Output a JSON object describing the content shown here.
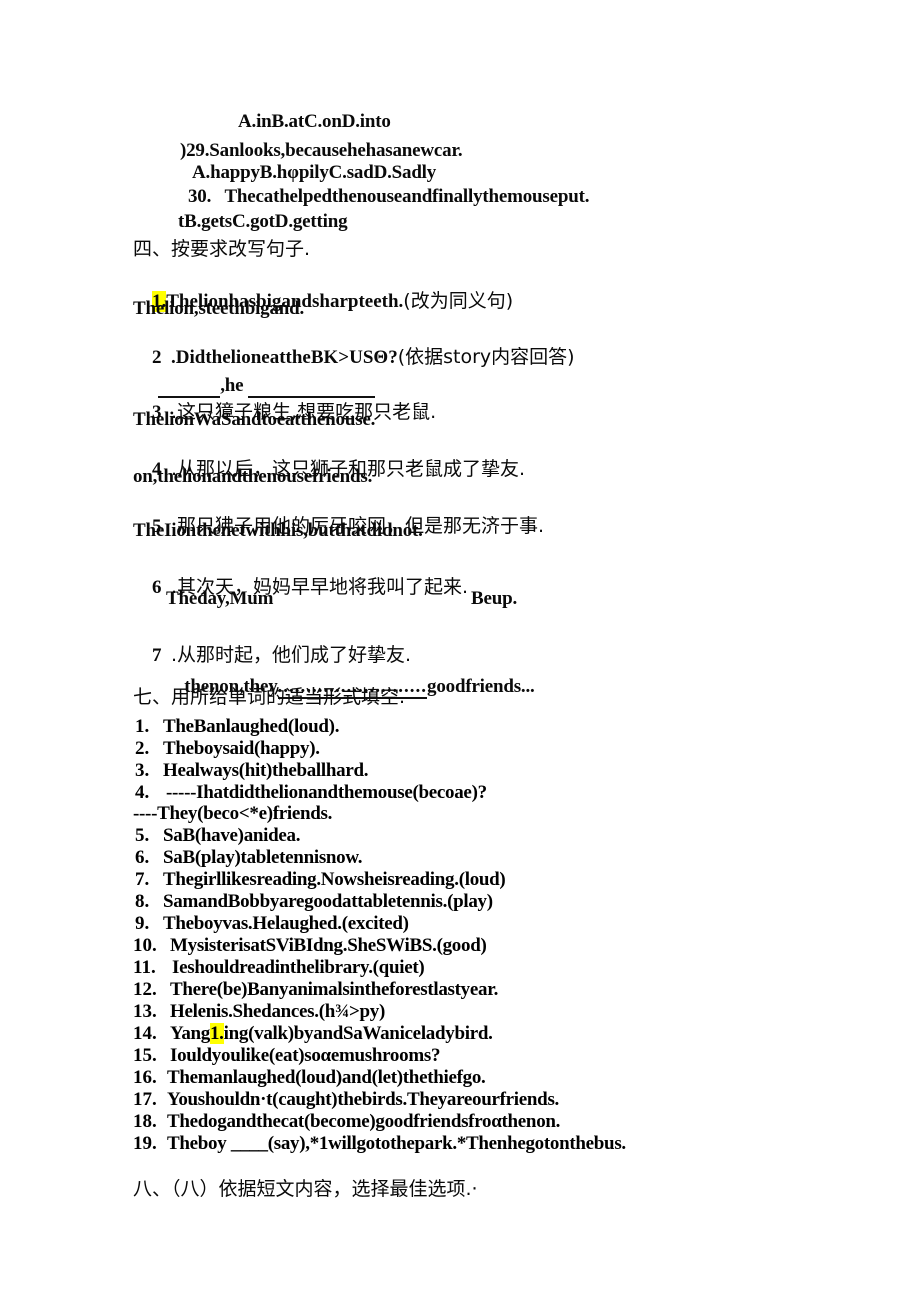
{
  "document": {
    "kind": "scanned-worksheet-page",
    "background_color": "#ffffff",
    "text_color": "#000000",
    "highlight_color": "#ffff00"
  },
  "top_questions": {
    "q28_options": "A.inB.atC.onD.into",
    "q29_stem": ")29.Sanlooks,becausehehasanewcar.",
    "q29_options": "A.happyB.hφpilyC.sadD.Sadly",
    "q30_stem": "30.   Thecathelpedthenouseandfinallythemouseput.",
    "q30_options": "tB.getsC.gotD.getting"
  },
  "section_four": {
    "heading": "四、按要求改写句子.",
    "items": [
      {
        "number": "1.",
        "number_highlighted": true,
        "prompt_en": "Thelionhasbigandsharpteeth.",
        "prompt_cn": "(改为同义句)",
        "answer": "Thelion,steethbigand."
      },
      {
        "number": "2",
        "prompt_en": ".DidthelioneattheBK>USΘ?",
        "prompt_cn": "(依据story内容回答)",
        "answer_fragment": ",he"
      },
      {
        "number": "3",
        "prompt_cn": ".这只獐子粮生,想要吃那只老鼠.",
        "answer": "ThelionWaSandtoeatthenouse."
      },
      {
        "number": "4",
        "prompt_cn": ".从那以后，这只狮子和那只老鼠成了挚友.",
        "answer": "on,thelionandthenousefriends."
      },
      {
        "number": "5",
        "prompt_cn": ".那只狒子用他的厉牙咬网，但是那无济于事.",
        "answer": "TheIionthenetwithhis,butthatdidnot."
      },
      {
        "number": "6",
        "prompt_cn": ".其次天，妈妈早早地将我叫了起来.",
        "answer_left": "Theday,Mum",
        "answer_right": "Beup."
      },
      {
        "number": "7",
        "prompt_cn": ".从那时起，他们成了好挚友.",
        "answer_left": "thenon,they",
        "answer_dots": "..........................",
        "answer_right": "goodfriends..."
      }
    ]
  },
  "section_seven": {
    "heading": "七、用所给单词的适当形式填空.",
    "items": [
      {
        "number": "1.",
        "text": "TheBanlaughed(loud)."
      },
      {
        "number": "2.",
        "text": "Theboysaid(happy)."
      },
      {
        "number": "3.",
        "text": "Healways(hit)theballhard."
      },
      {
        "number": "4.",
        "text": "-----Ihatdidthelionandthemouse(becoae)?"
      },
      {
        "number": "",
        "text": "----They(beco<*e)friends."
      },
      {
        "number": "5.",
        "text": "SaB(have)anidea."
      },
      {
        "number": "6.",
        "text": "SaB(play)tabletennisnow."
      },
      {
        "number": "7.",
        "text": "Thegirllikesreading.Nowsheisreading.(loud)"
      },
      {
        "number": "8.",
        "text": "SamandBobbyaregoodattabletennis.(play)"
      },
      {
        "number": "9.",
        "text": "Theboyvas.Helaughed.(excited)"
      },
      {
        "number": "10.",
        "text": "MysisterisatSViBIdng.SheSWiBS.(good)"
      },
      {
        "number": "11.",
        "text": "Ieshouldreadinthelibrary.(quiet)"
      },
      {
        "number": "12.",
        "text": "There(be)Banyanimalsintheforestlastyear."
      },
      {
        "number": "13.",
        "text": "Helenis.Shedances.(h¾>py)"
      },
      {
        "number": "14.",
        "text_before": "Yang",
        "highlight": "1.",
        "text_after": "ing(valk)byandSaWaniceladybird."
      },
      {
        "number": "15.",
        "text": "Iouldyoulike(eat)soαemushrooms?"
      },
      {
        "number": "16.",
        "text": "Themanlaughed(loud)and(let)thethiefgo."
      },
      {
        "number": "17.",
        "text": "Youshouldn·t(caught)thebirds.Theyareourfriends."
      },
      {
        "number": "18.",
        "text": "Thedogandthecat(become)goodfriendsfroαthenon."
      },
      {
        "number": "19.",
        "text_before": "Theboy ",
        "blank": "____",
        "text_after": "(say),*1willgotothepark.*Thenhegotonthebus."
      }
    ]
  },
  "section_eight": {
    "heading": "八、（八）依据短文内容，选择最佳选项.·"
  }
}
